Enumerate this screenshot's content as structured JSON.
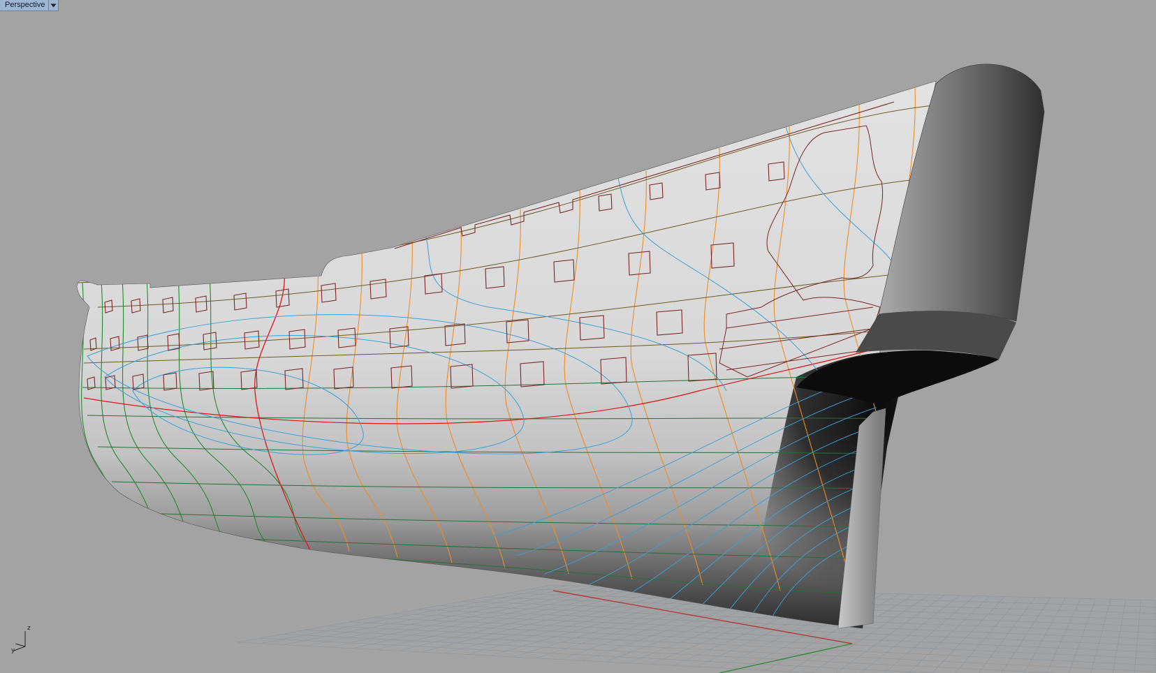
{
  "viewport": {
    "name": "Perspective",
    "menu_icon": "triangle-down-icon",
    "background_color": "#a3a3a3"
  },
  "axis_widget": {
    "z_label": "z",
    "y_label": "y"
  },
  "colors": {
    "hull_light": "#dcdcdc",
    "hull_dark": "#1e1e1e",
    "station_orange": "#f08c1e",
    "station_green": "#1f8a2a",
    "station_red": "#e01414",
    "waterline_blue": "#3aa0d8",
    "gunport_brown": "#7a2626",
    "wale_olive": "#6b5a20",
    "grid_line": "#8f969c",
    "axis_x": "#c03030",
    "axis_y": "#2e8b3a"
  }
}
